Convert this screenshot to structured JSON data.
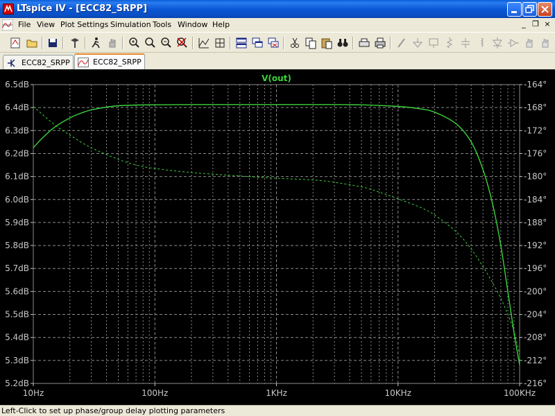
{
  "window": {
    "title": "LTspice IV - [ECC82_SRPP]"
  },
  "menu": {
    "items": [
      "File",
      "View",
      "Plot Settings",
      "Simulation",
      "Tools",
      "Window",
      "Help"
    ],
    "mdi_controls": [
      "_",
      "❐",
      "×"
    ]
  },
  "toolbar": {
    "icons": [
      "new-schematic-icon",
      "open-icon",
      "save-icon",
      "control-panel-icon",
      "run-icon",
      "halt-icon",
      "zoom-area-icon",
      "zoom-in-icon",
      "zoom-out-icon",
      "zoom-cancel-icon",
      "autorange-icon",
      "mark-unconnected-icon",
      "tile-icon",
      "cascade-icon",
      "close-all-icon",
      "cut-icon",
      "copy-icon",
      "paste-icon",
      "find-icon",
      "print-preview-icon",
      "print-icon",
      "wire-icon",
      "ground-icon",
      "label-icon",
      "resistor-icon",
      "capacitor-icon",
      "inductor-icon",
      "diode-icon",
      "component-icon",
      "move-icon",
      "drag-icon"
    ]
  },
  "tabs": [
    {
      "label": "ECC82_SRPP",
      "icon": "schematic-icon",
      "active": false
    },
    {
      "label": "ECC82_SRPP",
      "icon": "waveform-icon",
      "active": true
    }
  ],
  "colors": {
    "trace": "#3cd23c",
    "grid": "#8c8c8c",
    "axis_label": "#c8c8c8",
    "background": "#000000"
  },
  "chart_data": {
    "type": "line",
    "title": "V(out)",
    "xscale": "log",
    "xlim": [
      10,
      100000
    ],
    "x_ticks": [
      "10Hz",
      "100Hz",
      "1KHz",
      "10KHz",
      "100KHz"
    ],
    "ylim_left": [
      5.2,
      6.5
    ],
    "y_ticks_left": [
      "6.5dB",
      "6.4dB",
      "6.3dB",
      "6.2dB",
      "6.1dB",
      "6.0dB",
      "5.9dB",
      "5.8dB",
      "5.7dB",
      "5.6dB",
      "5.5dB",
      "5.4dB",
      "5.3dB",
      "5.2dB"
    ],
    "ylim_right": [
      -216,
      -164
    ],
    "y_ticks_right": [
      "-164°",
      "-168°",
      "-172°",
      "-176°",
      "-180°",
      "-184°",
      "-188°",
      "-192°",
      "-196°",
      "-200°",
      "-204°",
      "-208°",
      "-212°",
      "-216°"
    ],
    "series": [
      {
        "name": "magnitude",
        "axis": "left",
        "style": "solid",
        "x": [
          10,
          12,
          15,
          20,
          25,
          30,
          40,
          50,
          70,
          100,
          200,
          500,
          1000,
          2000,
          5000,
          10000,
          15000,
          20000,
          30000,
          40000,
          50000,
          60000,
          70000,
          80000,
          90000,
          100000
        ],
        "y": [
          6.225,
          6.27,
          6.315,
          6.355,
          6.377,
          6.39,
          6.402,
          6.408,
          6.411,
          6.412,
          6.413,
          6.413,
          6.413,
          6.413,
          6.412,
          6.405,
          6.395,
          6.38,
          6.33,
          6.25,
          6.13,
          5.98,
          5.8,
          5.6,
          5.42,
          5.28
        ]
      },
      {
        "name": "phase",
        "axis": "right",
        "style": "dashed",
        "x": [
          10,
          15,
          20,
          30,
          50,
          70,
          100,
          200,
          500,
          1000,
          2000,
          3000,
          5000,
          7000,
          10000,
          15000,
          20000,
          30000,
          40000,
          50000,
          60000,
          70000,
          80000,
          90000,
          100000
        ],
        "y": [
          -167.8,
          -171.0,
          -172.8,
          -175.0,
          -177.0,
          -178.0,
          -178.6,
          -179.3,
          -179.9,
          -180.3,
          -180.6,
          -181.0,
          -181.8,
          -182.7,
          -183.9,
          -185.3,
          -186.7,
          -189.6,
          -192.6,
          -195.7,
          -198.5,
          -201.2,
          -204.0,
          -207.0,
          -211.0
        ]
      }
    ]
  },
  "statusbar": {
    "text": "Left-Click to set up phase/group delay plotting parameters"
  }
}
